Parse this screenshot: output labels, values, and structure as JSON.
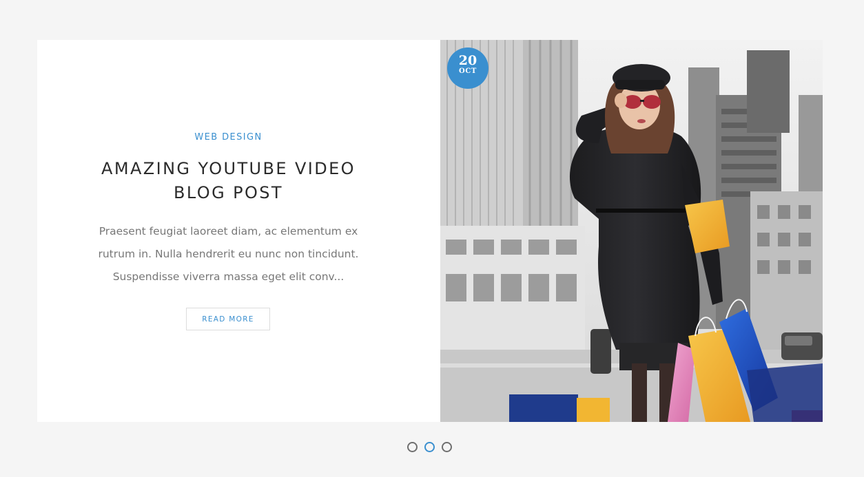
{
  "post": {
    "category": "WEB DESIGN",
    "title": "AMAZING YOUTUBE VIDEO BLOG POST",
    "excerpt": "Praesent feugiat laoreet diam, ac elementum ex rutrum in. Nulla hendrerit eu nunc non tincidunt. Suspendisse viverra massa eget elit conv...",
    "read_more_label": "READ MORE",
    "date": {
      "day": "20",
      "month": "OCT"
    }
  },
  "slider": {
    "total_slides": 3,
    "active_index": 1
  },
  "colors": {
    "accent": "#3a8fcf",
    "page_background": "#f5f5f5",
    "card_background": "#ffffff",
    "title_text": "#2b2b2b",
    "body_text": "#777777",
    "dot_inactive": "#6f6f6f"
  }
}
